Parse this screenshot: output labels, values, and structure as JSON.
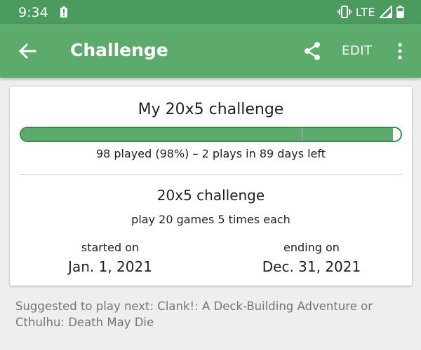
{
  "status_bar": {
    "time": "9:34",
    "network": "LTE",
    "icons": [
      "battery-alert-icon",
      "vibrate-icon",
      "signal-icon",
      "battery-icon"
    ]
  },
  "app_bar": {
    "title": "Challenge",
    "edit_label": "EDIT",
    "icons": [
      "back-arrow-icon",
      "share-icon",
      "more-vert-icon"
    ]
  },
  "card": {
    "title": "My 20x5 challenge",
    "progress": {
      "fraction": 0.98,
      "expected_fraction": 0.74,
      "summary": "98 played (98%) – 2 plays in 89 days left"
    },
    "challenge_name": "20x5 challenge",
    "challenge_description": "play 20 games 5 times each",
    "start_label": "started on",
    "start_date": "Jan. 1, 2021",
    "end_label": "ending on",
    "end_date": "Dec. 31, 2021"
  },
  "suggestion": "Suggested to play next: Clank!: A Deck-Building Adventure or Cthulhu: Death May Die",
  "colors": {
    "status_bar": "#4b9a5e",
    "app_bar": "#5daa6d",
    "progress_fill": "#5daa6d",
    "progress_border": "#3d8a50"
  }
}
